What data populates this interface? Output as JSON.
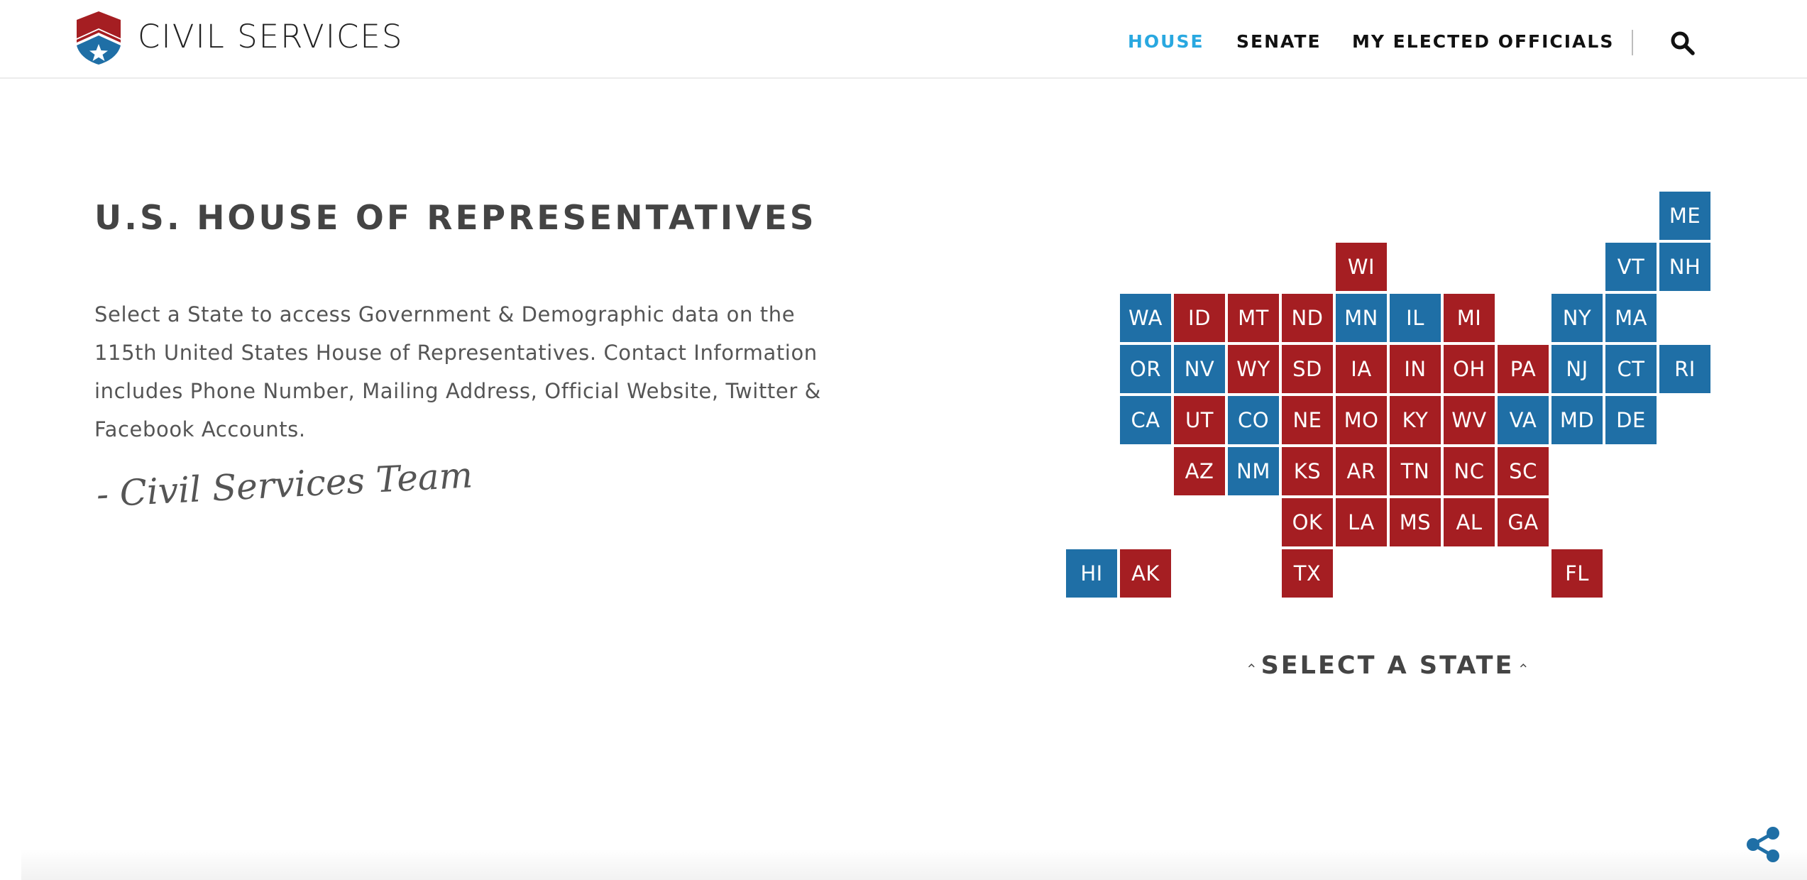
{
  "header": {
    "brand": "CIVIL SERVICES",
    "logo_icon": "shield-star-logo",
    "nav": [
      {
        "label": "HOUSE",
        "active": true
      },
      {
        "label": "SENATE",
        "active": false
      },
      {
        "label": "MY ELECTED OFFICIALS",
        "active": false
      }
    ],
    "search_icon": "search-icon"
  },
  "main": {
    "title": "U.S. HOUSE OF REPRESENTATIVES",
    "description": "Select a State to access Government & Demographic data on the 115th United States House of Representatives. Contact Information includes Phone Number, Mailing Address, Official Website, Twitter & Facebook Accounts.",
    "signature": "- Civil Services Team"
  },
  "map": {
    "colors": {
      "blue": "#1f6fa6",
      "red": "#a51e22"
    },
    "states": [
      {
        "abbr": "ME",
        "color": "blue"
      },
      {
        "abbr": "WI",
        "color": "red"
      },
      {
        "abbr": "VT",
        "color": "blue"
      },
      {
        "abbr": "NH",
        "color": "blue"
      },
      {
        "abbr": "WA",
        "color": "blue"
      },
      {
        "abbr": "ID",
        "color": "red"
      },
      {
        "abbr": "MT",
        "color": "red"
      },
      {
        "abbr": "ND",
        "color": "red"
      },
      {
        "abbr": "MN",
        "color": "blue"
      },
      {
        "abbr": "IL",
        "color": "blue"
      },
      {
        "abbr": "MI",
        "color": "red"
      },
      {
        "abbr": "NY",
        "color": "blue"
      },
      {
        "abbr": "MA",
        "color": "blue"
      },
      {
        "abbr": "OR",
        "color": "blue"
      },
      {
        "abbr": "NV",
        "color": "blue"
      },
      {
        "abbr": "WY",
        "color": "red"
      },
      {
        "abbr": "SD",
        "color": "red"
      },
      {
        "abbr": "IA",
        "color": "red"
      },
      {
        "abbr": "IN",
        "color": "red"
      },
      {
        "abbr": "OH",
        "color": "red"
      },
      {
        "abbr": "PA",
        "color": "red"
      },
      {
        "abbr": "NJ",
        "color": "blue"
      },
      {
        "abbr": "CT",
        "color": "blue"
      },
      {
        "abbr": "RI",
        "color": "blue"
      },
      {
        "abbr": "CA",
        "color": "blue"
      },
      {
        "abbr": "UT",
        "color": "red"
      },
      {
        "abbr": "CO",
        "color": "blue"
      },
      {
        "abbr": "NE",
        "color": "red"
      },
      {
        "abbr": "MO",
        "color": "red"
      },
      {
        "abbr": "KY",
        "color": "red"
      },
      {
        "abbr": "WV",
        "color": "red"
      },
      {
        "abbr": "VA",
        "color": "blue"
      },
      {
        "abbr": "MD",
        "color": "blue"
      },
      {
        "abbr": "DE",
        "color": "blue"
      },
      {
        "abbr": "AZ",
        "color": "red"
      },
      {
        "abbr": "NM",
        "color": "blue"
      },
      {
        "abbr": "KS",
        "color": "red"
      },
      {
        "abbr": "AR",
        "color": "red"
      },
      {
        "abbr": "TN",
        "color": "red"
      },
      {
        "abbr": "NC",
        "color": "red"
      },
      {
        "abbr": "SC",
        "color": "red"
      },
      {
        "abbr": "OK",
        "color": "red"
      },
      {
        "abbr": "LA",
        "color": "red"
      },
      {
        "abbr": "MS",
        "color": "red"
      },
      {
        "abbr": "AL",
        "color": "red"
      },
      {
        "abbr": "GA",
        "color": "red"
      },
      {
        "abbr": "HI",
        "color": "blue"
      },
      {
        "abbr": "AK",
        "color": "red"
      },
      {
        "abbr": "TX",
        "color": "red"
      },
      {
        "abbr": "FL",
        "color": "red"
      }
    ],
    "prompt": "SELECT A STATE",
    "prompt_icon": "chevron-up-icon"
  },
  "share_icon": "share-icon"
}
